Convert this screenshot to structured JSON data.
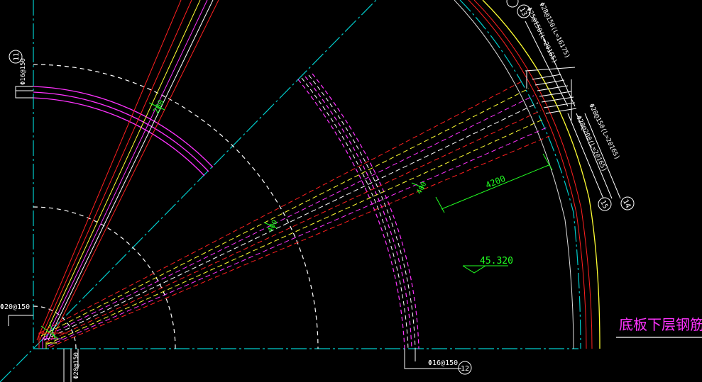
{
  "drawing": {
    "title": "底板下层钢筋",
    "elevation": "45.320",
    "dimension_radial": "4200",
    "dimension_top": "200",
    "dim_mid_1": "400",
    "dim_mid_2": "400",
    "tags": {
      "t11": "11",
      "t12": "12",
      "t13": "13",
      "t14": "14",
      "t15": "15"
    },
    "rebar_labels": {
      "left_top": "Φ16@150",
      "left_mid": "Φ20@150",
      "bottom_left": "Φ20@150",
      "bottom_mid": "Φ16@150",
      "right_1": "Φ28@150(L=16175)",
      "right_2": "Φ25@150(L=20165)",
      "right_3": "Φ28@150(L=20165)",
      "right_4": "Φ28@200(L=20165)"
    },
    "colors": {
      "background": "#000000",
      "axis": "#00cccc",
      "red": "#ff2020",
      "magenta": "#ff33ff",
      "yellow": "#ffff33",
      "white": "#ffffff",
      "green": "#22ff22",
      "title": "#ff33ff"
    }
  }
}
